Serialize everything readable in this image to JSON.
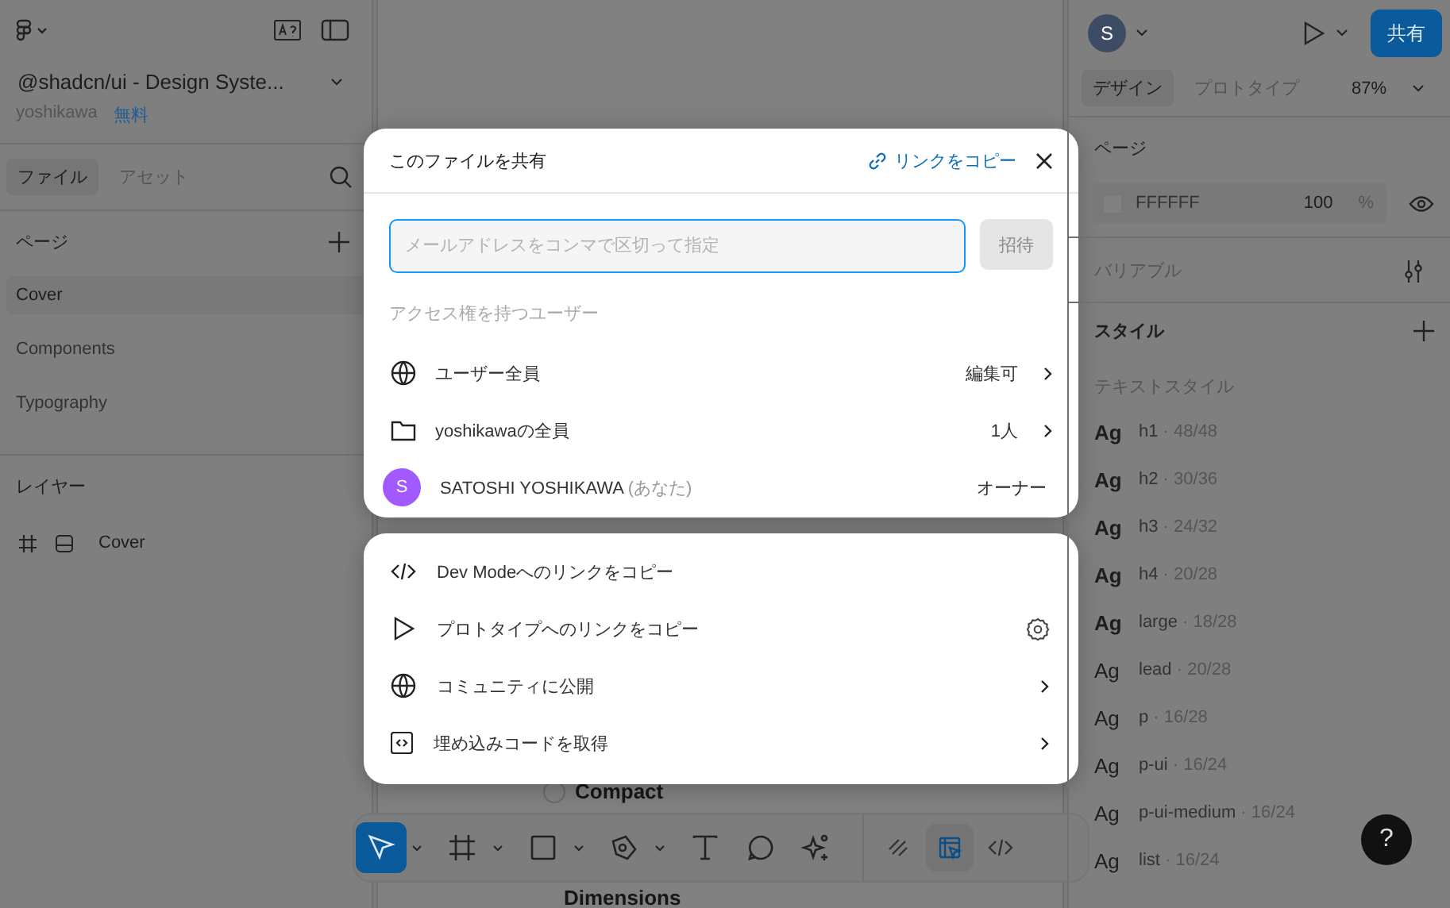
{
  "left_panel": {
    "file_name": "@shadcn/ui - Design Syste...",
    "owner": "yoshikawa",
    "plan_badge": "無料",
    "tabs": [
      {
        "label": "ファイル",
        "selected": true
      },
      {
        "label": "アセット",
        "selected": false
      }
    ],
    "pages_heading": "ページ",
    "pages": [
      {
        "label": "Cover",
        "selected": true
      },
      {
        "label": "Components",
        "selected": false
      },
      {
        "label": "Typography",
        "selected": false
      }
    ],
    "layers_heading": "レイヤー",
    "layers": [
      {
        "label": "Cover"
      }
    ]
  },
  "canvas": {
    "texts": [
      "Compact",
      "Dimensions"
    ]
  },
  "toolbar": {
    "tools": [
      {
        "kind": "move",
        "selected": true,
        "menu": true
      },
      {
        "kind": "frame",
        "selected": false,
        "menu": true
      },
      {
        "kind": "rectangle",
        "selected": false,
        "menu": true
      },
      {
        "kind": "pen",
        "selected": false,
        "menu": true
      },
      {
        "kind": "text",
        "selected": false,
        "menu": false
      },
      {
        "kind": "comment",
        "selected": false,
        "menu": false
      },
      {
        "kind": "sparkle",
        "selected": false,
        "menu": false
      }
    ],
    "modes": [
      {
        "kind": "draw",
        "selected": false
      },
      {
        "kind": "design",
        "selected": true
      },
      {
        "kind": "code",
        "selected": false
      }
    ]
  },
  "right_panel": {
    "avatar": "S",
    "share_button": "共有",
    "tabs": [
      {
        "label": "デザイン",
        "selected": true
      },
      {
        "label": "プロトタイプ",
        "selected": false
      }
    ],
    "zoom": "87%",
    "page_heading": "ページ",
    "fill_hex": "FFFFFF",
    "fill_opacity": "100",
    "percent": "%",
    "variables": "バリアブル",
    "styles_heading": "スタイル",
    "text_styles_heading": "テキストスタイル",
    "text_styles": [
      {
        "sample": "Ag",
        "name": "h1",
        "metrics": " · 48/48",
        "bold": true
      },
      {
        "sample": "Ag",
        "name": "h2",
        "metrics": " · 30/36",
        "bold": true
      },
      {
        "sample": "Ag",
        "name": "h3",
        "metrics": " · 24/32",
        "bold": true
      },
      {
        "sample": "Ag",
        "name": "h4",
        "metrics": " · 20/28",
        "bold": true
      },
      {
        "sample": "Ag",
        "name": "large",
        "metrics": " · 18/28",
        "bold": true
      },
      {
        "sample": "Ag",
        "name": "lead",
        "metrics": " · 20/28",
        "bold": false
      },
      {
        "sample": "Ag",
        "name": "p",
        "metrics": " · 16/28",
        "bold": false
      },
      {
        "sample": "Ag",
        "name": "p-ui",
        "metrics": " · 16/24",
        "bold": false
      },
      {
        "sample": "Ag",
        "name": "p-ui-medium",
        "metrics": " · 16/24",
        "bold": false
      },
      {
        "sample": "Ag",
        "name": "list",
        "metrics": " · 16/24",
        "bold": false
      }
    ],
    "help": "?"
  },
  "share_dialog": {
    "title": "このファイルを共有",
    "copy_link": "リンクをコピー",
    "email_placeholder": "メールアドレスをコンマで区切って指定",
    "invite_button": "招待",
    "invite_disabled": true,
    "access_heading": "アクセス権を持つユーザー",
    "access": [
      {
        "kind": "everyone",
        "name": "ユーザー全員",
        "role": "編集可",
        "chevron": true
      },
      {
        "kind": "team",
        "name": "yoshikawaの全員",
        "role": "1人",
        "chevron": true
      },
      {
        "kind": "user",
        "avatar": "S",
        "color": "#a259ff",
        "name": "SATOSHI YOSHIKAWA",
        "note": " (あなた)",
        "role": "オーナー",
        "chevron": false
      }
    ]
  },
  "share_actions": [
    {
      "kind": "code",
      "label": "Dev Modeへのリンクをコピー",
      "settings": false,
      "chevron": false
    },
    {
      "kind": "play",
      "label": "プロトタイプへのリンクをコピー",
      "settings": true,
      "chevron": false
    },
    {
      "kind": "globe",
      "label": "コミュニティに公開",
      "settings": false,
      "chevron": true
    },
    {
      "kind": "embed",
      "label": "埋め込みコードを取得",
      "settings": false,
      "chevron": true
    }
  ]
}
